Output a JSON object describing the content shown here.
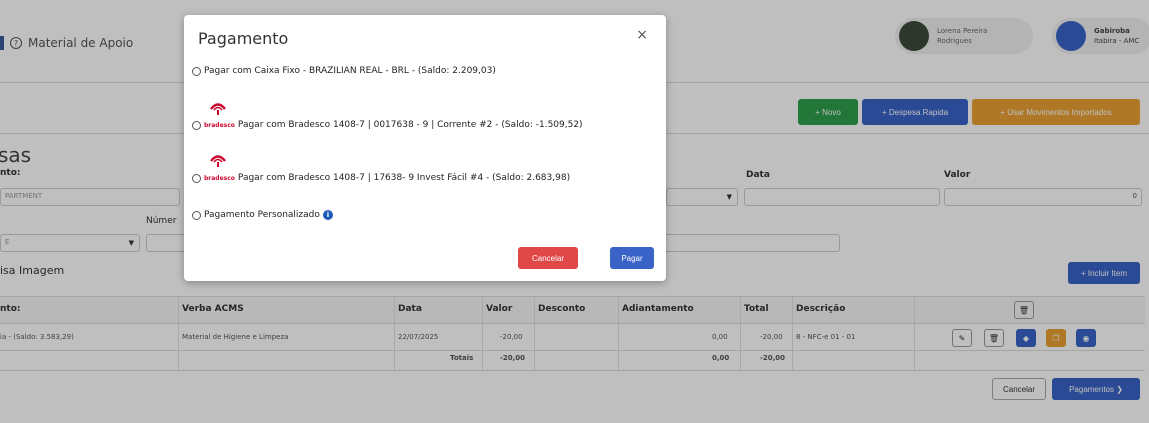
{
  "topbar": {
    "menu_label": "Material de Apoio",
    "user1": {
      "line1": "Lorena Pereira",
      "line2": "Rodrigues"
    },
    "user2": {
      "line1": "Gabiroba",
      "line2": "Itabira - AMC"
    }
  },
  "toolbar": {
    "novo": "+ Novo",
    "despesa_rapida": "+ Despesa Rapida",
    "usar_movimentos": "+ Usar Movimentos Importados"
  },
  "form": {
    "title": "sas",
    "label_nto": "nto:",
    "label_data": "Data",
    "label_valor": "Valor",
    "field_dept": "PARTMENT",
    "valor_value": "0",
    "label_numero": "Númer",
    "select_e": "E",
    "label_imagem": "isa Imagem",
    "incluir_item": "+ Incluir Item"
  },
  "table": {
    "headers": [
      "nto:",
      "Verba ACMS",
      "Data",
      "Valor",
      "Desconto",
      "Adiantamento",
      "Total",
      "Descrição"
    ],
    "row": [
      "ia - (Saldo: 3.583,29)",
      "Material de Higiene e Limpeza",
      "22/07/2025",
      "-20,00",
      "",
      "0,00",
      "-20,00",
      "8 - NFC-e 01 - 01"
    ],
    "totals_label": "Totais",
    "totals_valor": "-20,00",
    "totals_adiant": "0,00",
    "totals_total": "-20,00"
  },
  "footer": {
    "cancelar": "Cancelar",
    "pagamentos": "Pagamentos ❯"
  },
  "modal": {
    "title": "Pagamento",
    "close": "×",
    "options": [
      "Pagar com Caixa Fixo - BRAZILIAN REAL - BRL - (Saldo: 2.209,03)",
      "Pagar com Bradesco 1408-7 | 0017638 - 9 | Corrente #2 - (Saldo: -1.509,52)",
      "Pagar com Bradesco 1408-7 | 17638- 9 Invest Fácil #4 - (Saldo: 2.683,98)",
      "Pagamento Personalizado"
    ],
    "bradesco_word": "bradesco",
    "cancelar": "Cancelar",
    "pagar": "Pagar"
  },
  "colors": {
    "green": "#2e9e4b",
    "blue": "#3a63c8",
    "orange": "#e8a033",
    "red": "#e04848"
  }
}
